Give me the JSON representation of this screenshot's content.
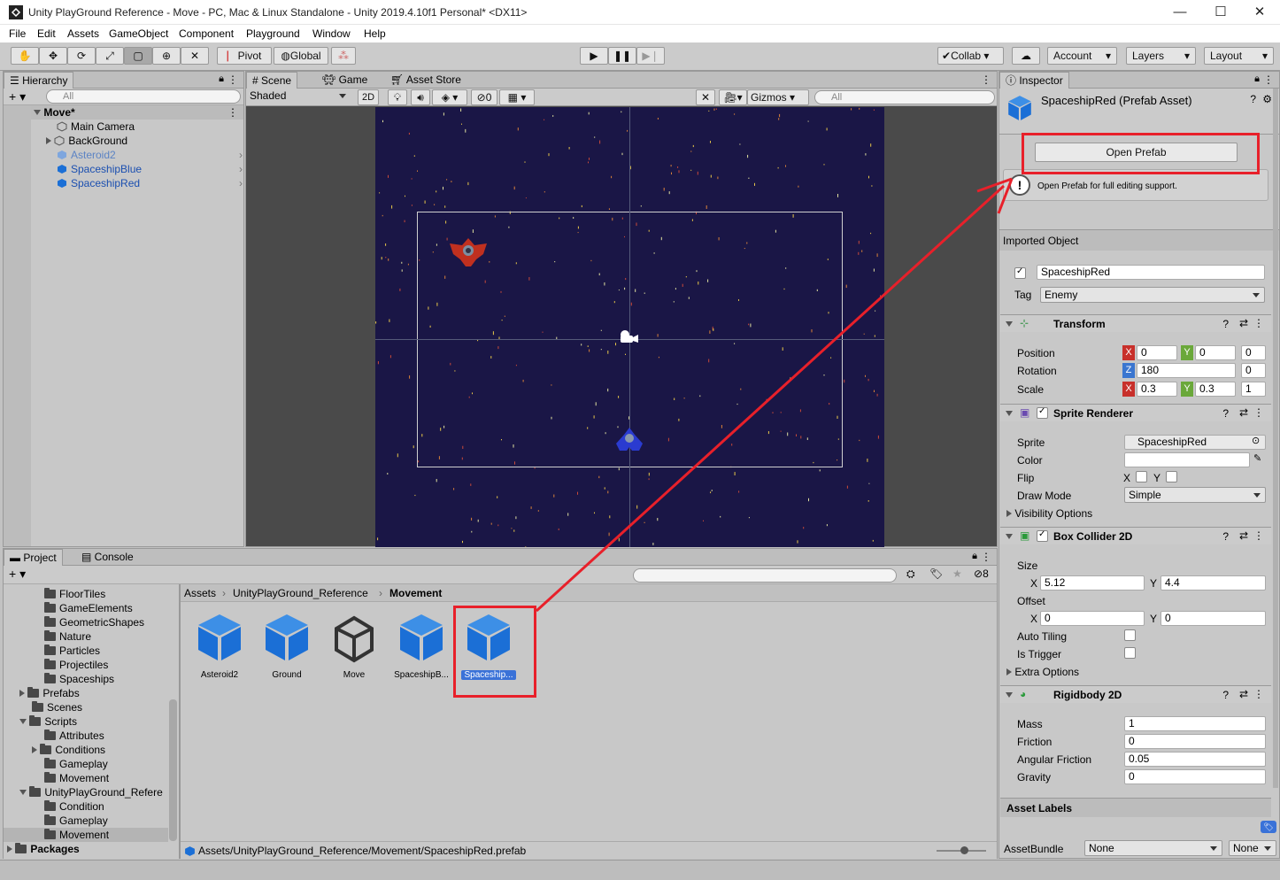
{
  "window": {
    "title": "Unity PlayGround Reference - Move - PC, Mac & Linux Standalone - Unity 2019.4.10f1 Personal* <DX11>",
    "minimize": "—",
    "maximize": "☐",
    "close": "✕"
  },
  "menu": [
    "File",
    "Edit",
    "Assets",
    "GameObject",
    "Component",
    "Playground",
    "Window",
    "Help"
  ],
  "toolbar": {
    "pivot": "Pivot",
    "global": "Global",
    "collab": "Collab",
    "account": "Account",
    "layers": "Layers",
    "layout": "Layout"
  },
  "hierarchy": {
    "tab": "Hierarchy",
    "search_placeholder": "All",
    "scene": "Move*",
    "items": [
      {
        "label": "Main Camera"
      },
      {
        "label": "BackGround"
      },
      {
        "label": "Asteroid2"
      },
      {
        "label": "SpaceshipBlue"
      },
      {
        "label": "SpaceshipRed"
      }
    ]
  },
  "scene_view": {
    "tabs": [
      "Scene",
      "Game",
      "Asset Store"
    ],
    "shading": "Shaded",
    "mode_2d": "2D",
    "hidden_count": "0",
    "gizmos": "Gizmos",
    "search_placeholder": "All"
  },
  "project": {
    "tabs": [
      "Project",
      "Console"
    ],
    "hidden_count": "8",
    "folders": [
      {
        "label": "FloorTiles"
      },
      {
        "label": "GameElements"
      },
      {
        "label": "GeometricShapes"
      },
      {
        "label": "Nature"
      },
      {
        "label": "Particles"
      },
      {
        "label": "Projectiles"
      },
      {
        "label": "Spaceships"
      },
      {
        "label": "Prefabs"
      },
      {
        "label": "Scenes"
      },
      {
        "label": "Scripts"
      },
      {
        "label": "Attributes"
      },
      {
        "label": "Conditions"
      },
      {
        "label": "Gameplay"
      },
      {
        "label": "Movement"
      },
      {
        "label": "UnityPlayGround_Refere"
      },
      {
        "label": "Condition"
      },
      {
        "label": "Gameplay"
      },
      {
        "label": "Movement"
      },
      {
        "label": "Packages"
      }
    ],
    "breadcrumb": [
      "Assets",
      "UnityPlayGround_Reference",
      "Movement"
    ],
    "assets": [
      {
        "label": "Asteroid2"
      },
      {
        "label": "Ground"
      },
      {
        "label": "Move"
      },
      {
        "label": "SpaceshipB..."
      },
      {
        "label": "Spaceship..."
      }
    ],
    "status_path": "Assets/UnityPlayGround_Reference/Movement/SpaceshipRed.prefab"
  },
  "inspector": {
    "tab": "Inspector",
    "title": "SpaceshipRed (Prefab Asset)",
    "open_prefab": "Open Prefab",
    "help_text": "Open Prefab for full editing support.",
    "imported_object": "Imported Object",
    "name": "SpaceshipRed",
    "tag_label": "Tag",
    "tag": "Enemy",
    "transform": {
      "title": "Transform",
      "position_label": "Position",
      "position": {
        "x": "0",
        "y": "0",
        "z": "0"
      },
      "rotation_label": "Rotation",
      "rotation": {
        "z": "180",
        "w": "0"
      },
      "scale_label": "Scale",
      "scale": {
        "x": "0.3",
        "y": "0.3",
        "z": "1"
      }
    },
    "sprite_renderer": {
      "title": "Sprite Renderer",
      "sprite_label": "Sprite",
      "sprite": "SpaceshipRed",
      "color_label": "Color",
      "flip_label": "Flip",
      "flip_x": "X",
      "flip_y": "Y",
      "draw_mode_label": "Draw Mode",
      "draw_mode": "Simple",
      "visibility": "Visibility Options"
    },
    "box_collider": {
      "title": "Box Collider 2D",
      "size_label": "Size",
      "size_x": "5.12",
      "size_y": "4.4",
      "offset_label": "Offset",
      "offset_x": "0",
      "offset_y": "0",
      "x": "X",
      "y": "Y",
      "auto_tiling": "Auto Tiling",
      "is_trigger": "Is Trigger",
      "extra": "Extra Options"
    },
    "rigidbody": {
      "title": "Rigidbody 2D",
      "mass_label": "Mass",
      "mass": "1",
      "friction_label": "Friction",
      "friction": "0",
      "angular_label": "Angular Friction",
      "angular": "0.05",
      "gravity_label": "Gravity",
      "gravity": "0"
    },
    "asset_labels": "Asset Labels",
    "assetbundle_label": "AssetBundle",
    "assetbundle": "None",
    "assetbundle_variant": "None"
  },
  "colors": {
    "accent": "#e8202a",
    "prefab_blue": "#1b6fd6",
    "scene_bg": "#1a1646",
    "selection": "#3a72d8"
  }
}
